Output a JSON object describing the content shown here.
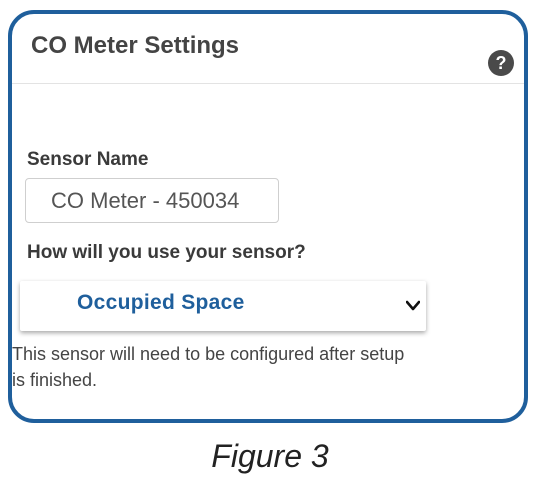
{
  "panel": {
    "title": "CO Meter Settings",
    "help_icon": "question-mark-icon",
    "help_glyph": "?",
    "border_color": "#1f5f9c"
  },
  "sensor_name": {
    "label": "Sensor Name",
    "value": "CO Meter - 450034"
  },
  "usage": {
    "label": "How will you use your sensor?",
    "selected": "Occupied Space",
    "chevron_icon": "chevron-down-icon",
    "accent_color": "#1f5f9c"
  },
  "note": {
    "line1": "This sensor will need to be configured after setup",
    "line2": "is finished."
  },
  "caption": "Figure 3"
}
